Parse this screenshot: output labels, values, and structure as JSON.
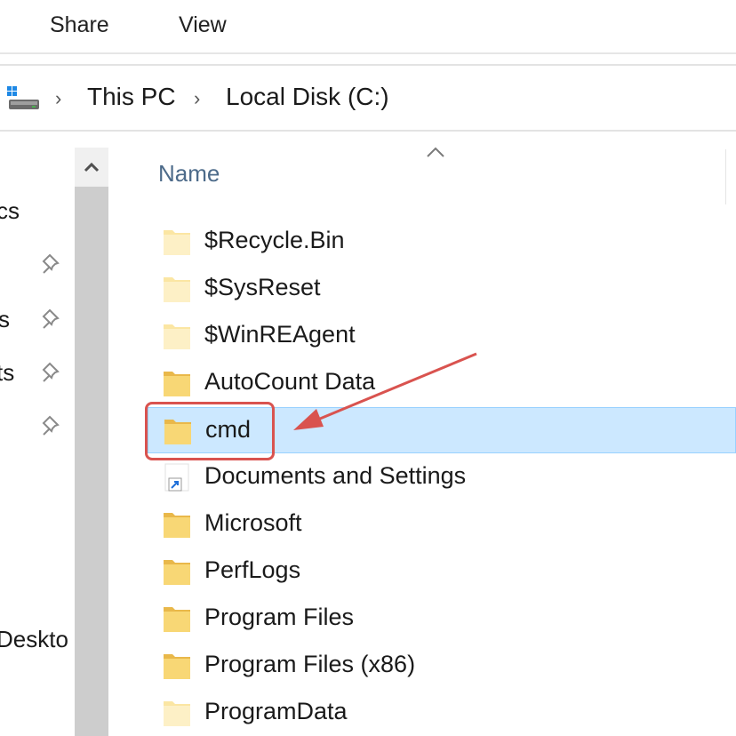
{
  "ribbon": {
    "tabs": [
      "Share",
      "View"
    ]
  },
  "address": {
    "crumbs": [
      "This PC",
      "Local Disk (C:)"
    ]
  },
  "nav": {
    "items": [
      {
        "label": "cs",
        "pinned": false
      },
      {
        "label": "",
        "pinned": true
      },
      {
        "label": "s",
        "pinned": true
      },
      {
        "label": "ts",
        "pinned": true
      },
      {
        "label": "",
        "pinned": true
      },
      {
        "label": "Deskto",
        "pinned": false
      }
    ]
  },
  "list": {
    "column_name": "Name",
    "rows": [
      {
        "label": "$Recycle.Bin",
        "type": "hidden-folder",
        "selected": false
      },
      {
        "label": "$SysReset",
        "type": "hidden-folder",
        "selected": false
      },
      {
        "label": "$WinREAgent",
        "type": "hidden-folder",
        "selected": false
      },
      {
        "label": "AutoCount Data",
        "type": "folder",
        "selected": false
      },
      {
        "label": "cmd",
        "type": "folder",
        "selected": true
      },
      {
        "label": "Documents and Settings",
        "type": "shortcut-folder",
        "selected": false
      },
      {
        "label": "Microsoft",
        "type": "folder",
        "selected": false
      },
      {
        "label": "PerfLogs",
        "type": "folder",
        "selected": false
      },
      {
        "label": "Program Files",
        "type": "folder",
        "selected": false
      },
      {
        "label": "Program Files (x86)",
        "type": "folder",
        "selected": false
      },
      {
        "label": "ProgramData",
        "type": "hidden-folder",
        "selected": false
      }
    ]
  },
  "colors": {
    "selection_bg": "#cce8ff",
    "annotation_red": "#d9534f",
    "folder_yellow": "#f8d775"
  }
}
